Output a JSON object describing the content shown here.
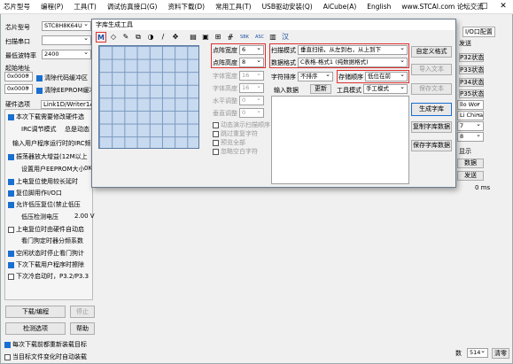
{
  "menu": [
    "芯片型号",
    "编程(P)",
    "工具(T)",
    "调试仿真接口(G)",
    "资料下载(D)",
    "常用工具(T)",
    "USB驱动安装(Q)",
    "AiCube(A)",
    "English",
    "www.STCAI.com 论坛交流"
  ],
  "left": {
    "chip_label": "芯片型号",
    "chip_value": "STC8H8K64U",
    "port_label": "扫描串口",
    "baud_label": "最低波特率",
    "baud_value": "2400",
    "start_addr_label": "起始地址",
    "addr1": "0x0000",
    "addr1_chk": "清除代码缓冲区",
    "addr2": "0x0000",
    "addr2_chk": "清除EEPROM缓冲区",
    "hw_label": "硬件选项",
    "hw_value": "Link1D/Writer1A",
    "opt1": "本次下载需要修改硬件选",
    "opt2": "IRC调节模式",
    "opt2b": "总是动态",
    "opt3": "输入用户程序运行时的IRC频",
    "opt4": "振荡器放大增益(12M以上",
    "opt5": "设置用户EEPROM大小",
    "opt5b": "0K",
    "opt6": "上电复位使用较长延时",
    "opt7": "复位脚用作I/O口",
    "opt8": "允许低压复位(禁止低压",
    "opt9": "低压检测电压",
    "opt9b": "2.00 V",
    "opt10": "上电复位时由硬件自动启",
    "opt11": "看门狗定时器分频系数",
    "opt12": "空闲状态时停止看门狗计",
    "opt13": "下次下载用户程序时擦除",
    "opt14": "下次冷启动时，P3.2/P3.3",
    "btn_download": "下载/编程",
    "btn_stop": "停止",
    "btn_check": "检测选项",
    "btn_help": "帮助",
    "bottom1": "每次下载前都重新装载目标",
    "bottom2": "当目标文件变化时自动装载"
  },
  "right": {
    "tab": "I/O口配置",
    "send_label": "发送",
    "p32": "P32状态",
    "p33": "P33状态",
    "p34": "P34状态",
    "p35": "P35状态",
    "hello": "llo Wor",
    "china": "Li China",
    "v7": "7",
    "v8": "8",
    "show": "显示",
    "data_btn": "数据",
    "send_btn": "发送",
    "ms": "0 ms",
    "count_label": "数",
    "count_value": "514",
    "clear_btn": "清零"
  },
  "dialog": {
    "title": "字库生成工具",
    "toolbar_m": "M",
    "toolbar_extra": [
      "SBK",
      "ASC",
      "汉"
    ],
    "width_label": "点阵宽度",
    "width_value": "6",
    "height_label": "点阵高度",
    "height_value": "8",
    "fw_label": "字体宽度",
    "fw_value": "16",
    "fh_label": "字体高度",
    "fh_value": "16",
    "hadj_label": "水平调整",
    "hadj_value": "0",
    "vadj_label": "垂直调整",
    "vadj_value": "0",
    "cb1": "动态演示扫描顺序",
    "cb2": "跳过重复字符",
    "cb3": "预览全部",
    "cb4": "忽略空白字符",
    "scan_label": "扫描模式",
    "scan_value": "垂直扫描，从左到右，从上到下",
    "fmt_label": "数据格式",
    "fmt_value": "C表格-格式1 (纯数据格式)",
    "sort_label": "字符排序",
    "sort_value": "不排序",
    "order_label": "存储顺序",
    "order_value": "低位在前",
    "input_label": "输入数据",
    "update_btn": "更新",
    "tools_label": "工具模式",
    "tools_value": "手工模式",
    "btn_custom": "自定义格式",
    "btn_import": "导入文本",
    "btn_save_text": "保存文本",
    "btn_generate": "生成字库",
    "btn_copy": "复制字库数据",
    "btn_save_data": "保存字库数据"
  }
}
